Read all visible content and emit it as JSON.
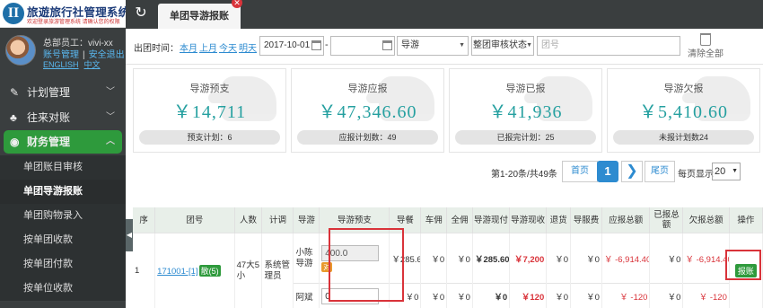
{
  "app": {
    "logo_mark": "II",
    "title": "旅遊旅行社管理系统",
    "subtitle": "欢迎登录旅游管理系统 请确认您的权限"
  },
  "user": {
    "name": "总部员工：vivi-xx",
    "account_label": "账号管理",
    "logout_label": "安全退出",
    "lang_en": "ENGLISH",
    "lang_cn": "中文"
  },
  "sidebar": {
    "menus": [
      {
        "label": "计划管理"
      },
      {
        "label": "往来对账"
      },
      {
        "label": "财务管理"
      }
    ],
    "subitems": [
      {
        "label": "单团账目审核"
      },
      {
        "label": "单团导游报账"
      },
      {
        "label": "单团购物录入"
      },
      {
        "label": "按单团收款"
      },
      {
        "label": "按单团付款"
      },
      {
        "label": "按单位收款"
      }
    ]
  },
  "tabs": {
    "active": "单团导游报账"
  },
  "filters": {
    "date_label": "出团时间：",
    "quick": [
      "本月",
      "上月",
      "今天",
      "明天"
    ],
    "date_from": "2017-10-01",
    "date_sep": "-",
    "date_to": "",
    "guide_select": "导游",
    "status_select": "整团审核状态",
    "tour_placeholder": "团号",
    "clear_all": "清除全部"
  },
  "stats": [
    {
      "title": "导游预支",
      "value": "￥14,711",
      "foot": "预支计划：6"
    },
    {
      "title": "导游应报",
      "value": "￥47,346.60",
      "foot": "应报计划数：49"
    },
    {
      "title": "导游已报",
      "value": "￥41,936",
      "foot": "已报完计划：25"
    },
    {
      "title": "导游欠报",
      "value": "￥5,410.60",
      "foot": "未报计划数24"
    }
  ],
  "pager": {
    "info": "第1-20条/共49条",
    "first": "首页",
    "current": "1",
    "next": "❯",
    "last": "尾页",
    "per_label": "每页显示",
    "per_value": "20"
  },
  "grid": {
    "headers": [
      "序",
      "团号",
      "人数",
      "计调",
      "导游",
      "导游预支",
      "导餐",
      "车佣",
      "全佣",
      "导游现付",
      "导游现收",
      "退货",
      "导服费",
      "应报总额",
      "已报总额",
      "欠报总额",
      "操作"
    ],
    "row": {
      "seq": "1",
      "tour_no": "171001-[1]",
      "badge": "散(5)",
      "people": "47大5小",
      "planner": "系统管理员",
      "op": "报账"
    },
    "guides": [
      {
        "name": "小陈导游",
        "advance": "400.0",
        "advance_badge": "对",
        "meal": "￥285.60",
        "car": "￥0",
        "full": "￥0",
        "cash_pay": "￥285.60",
        "cash_recv": "￥7,200",
        "refund": "￥0",
        "service": "￥0",
        "should": "￥ -6,914.40",
        "reported": "￥0",
        "owed": "￥ -6,914.40"
      },
      {
        "name": "阿斌",
        "advance": "0",
        "meal": "￥0",
        "car": "￥0",
        "full": "￥0",
        "cash_pay": "￥0",
        "cash_recv": "￥120",
        "refund": "￥0",
        "service": "￥0",
        "should": "￥ -120",
        "reported": "￥0",
        "owed": "￥ -120"
      }
    ]
  },
  "colors": {
    "accent_green": "#2e9a3c",
    "stat_teal": "#25a0a0",
    "link_blue": "#2d8bd0",
    "warn_red": "#d9333a",
    "sidebar_dark": "#3a3e3f"
  }
}
